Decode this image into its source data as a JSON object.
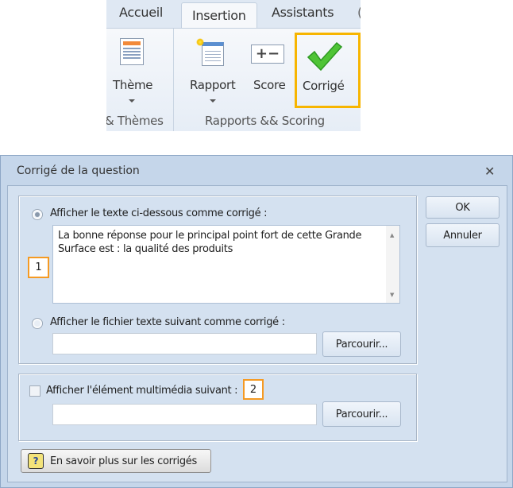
{
  "ribbon": {
    "tabs": [
      {
        "label": "Accueil"
      },
      {
        "label": "Insertion",
        "active": true
      },
      {
        "label": "Assistants"
      }
    ],
    "buttons": {
      "theme": "Thème",
      "rapport": "Rapport",
      "score": "Score",
      "corrige": "Corrigé"
    },
    "groups": {
      "themes": "& Thèmes",
      "rapports": "Rapports && Scoring"
    },
    "highlight_color": "#f7b500"
  },
  "dialog": {
    "title": "Corrigé de la question",
    "option_text_label": "Afficher le texte ci-dessous comme corrigé :",
    "option_text_selected": true,
    "answer_text": "La bonne réponse pour le principal point fort de cette Grande Surface est : la qualité des produits",
    "option_file_label": "Afficher le fichier texte suivant comme corrigé :",
    "option_file_selected": false,
    "file_value": "",
    "browse_label": "Parcourir...",
    "multimedia_label": "Afficher l'élément multimédia suivant :",
    "multimedia_checked": false,
    "multimedia_value": "",
    "help_label": "En savoir plus sur les corrigés",
    "ok_label": "OK",
    "cancel_label": "Annuler",
    "badges": [
      "1",
      "2"
    ],
    "badge_color": "#f59a23"
  }
}
